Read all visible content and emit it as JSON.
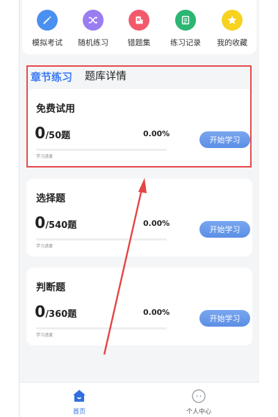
{
  "quick_menu": [
    {
      "label": "模拟考试",
      "icon": "pencil-icon",
      "color": "#4a90f0"
    },
    {
      "label": "随机练习",
      "icon": "shuffle-icon",
      "color": "#9a7df0"
    },
    {
      "label": "错题集",
      "icon": "error-book-icon",
      "color": "#f25a6b"
    },
    {
      "label": "练习记录",
      "icon": "record-icon",
      "color": "#2bb673"
    },
    {
      "label": "我的收藏",
      "icon": "star-icon",
      "color": "#f7d21e"
    }
  ],
  "section": {
    "active_tab": "章节练习",
    "other_tab": "题库详情"
  },
  "cards": [
    {
      "title": "免费试用",
      "done": "0",
      "total_text": "/50题",
      "percent": "0.00%",
      "progress": 0,
      "progress_label": "学习进度",
      "button": "开始学习"
    },
    {
      "title": "选择题",
      "done": "0",
      "total_text": "/540题",
      "percent": "0.00%",
      "progress": 0,
      "progress_label": "学习进度",
      "button": "开始学习"
    },
    {
      "title": "判断题",
      "done": "0",
      "total_text": "/360题",
      "percent": "0.00%",
      "progress": 0,
      "progress_label": "学习进度",
      "button": "开始学习"
    }
  ],
  "tabbar": {
    "home": "首页",
    "profile": "个人中心"
  },
  "colors": {
    "accent": "#3a7bf5",
    "annotation": "#e64545"
  }
}
